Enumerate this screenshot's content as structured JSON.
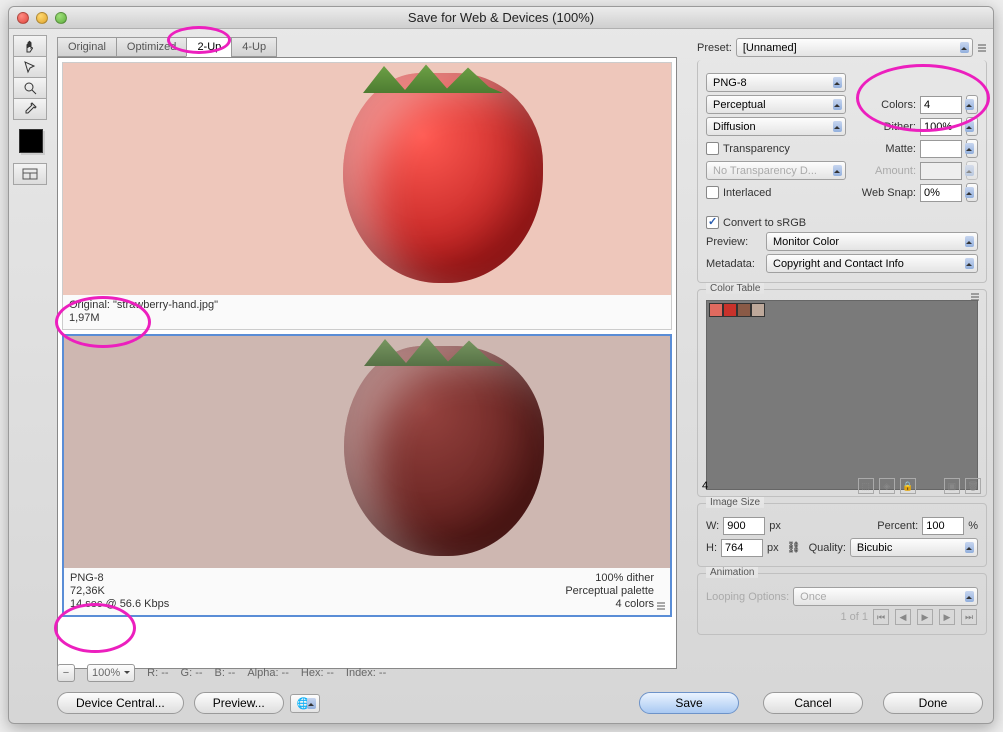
{
  "window": {
    "title": "Save for Web & Devices (100%)"
  },
  "tools": [
    "hand",
    "slice",
    "zoom",
    "eyedropper"
  ],
  "tabs": {
    "items": [
      "Original",
      "Optimized",
      "2-Up",
      "4-Up"
    ],
    "active": 2
  },
  "preview": {
    "original": {
      "line1": "Original: \"strawberry-hand.jpg\"",
      "line2": "1,97M"
    },
    "optimized": {
      "left1": "PNG-8",
      "left2": "72,36K",
      "left3": "14 sec @ 56.6 Kbps",
      "right1": "100% dither",
      "right2": "Perceptual palette",
      "right3": "4 colors"
    }
  },
  "zoom": {
    "value": "100%"
  },
  "readout": {
    "r": "R: --",
    "g": "G: --",
    "b": "B: --",
    "alpha": "Alpha: --",
    "hex": "Hex: --",
    "index": "Index: --"
  },
  "buttons": {
    "device": "Device Central...",
    "preview": "Preview...",
    "save": "Save",
    "cancel": "Cancel",
    "done": "Done"
  },
  "settings": {
    "presetLabel": "Preset:",
    "preset": "[Unnamed]",
    "format": "PNG-8",
    "algorithm": "Perceptual",
    "colorsLabel": "Colors:",
    "colors": "4",
    "ditherMethod": "Diffusion",
    "ditherLabel": "Dither:",
    "dither": "100%",
    "transparencyLabel": "Transparency",
    "matteLabel": "Matte:",
    "matte": "",
    "noTransparencyDither": "No Transparency D...",
    "amountLabel": "Amount:",
    "amount": "",
    "interlacedLabel": "Interlaced",
    "webSnapLabel": "Web Snap:",
    "webSnap": "0%",
    "convertSRGB": "Convert to sRGB",
    "previewLabel": "Preview:",
    "previewValue": "Monitor Color",
    "metadataLabel": "Metadata:",
    "metadataValue": "Copyright and Contact Info"
  },
  "colorTable": {
    "title": "Color Table",
    "count": "4",
    "swatches": [
      "#e06a5f",
      "#c8322b",
      "#8a5a46",
      "#bda89a"
    ]
  },
  "imageSize": {
    "title": "Image Size",
    "wLabel": "W:",
    "w": "900",
    "hLabel": "H:",
    "h": "764",
    "px": "px",
    "percentLabel": "Percent:",
    "percent": "100",
    "percentUnit": "%",
    "qualityLabel": "Quality:",
    "quality": "Bicubic"
  },
  "animation": {
    "title": "Animation",
    "loopLabel": "Looping Options:",
    "loop": "Once",
    "frame": "1 of 1"
  }
}
